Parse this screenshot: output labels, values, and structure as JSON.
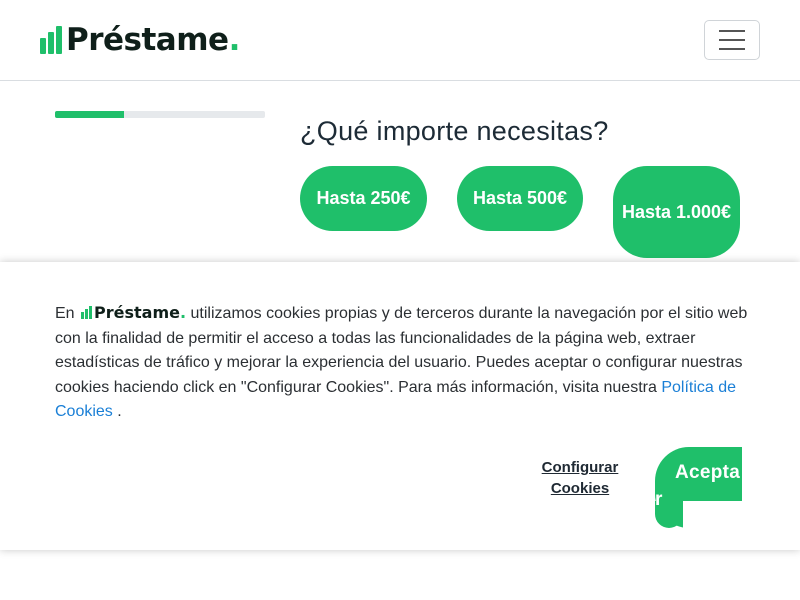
{
  "header": {
    "logo_text": "Préstame",
    "logo_dot": ".",
    "menu_icon": "hamburger-icon"
  },
  "progress": {
    "fraction": 0.33
  },
  "question": {
    "title": "¿Qué importe necesitas?",
    "options": [
      "Hasta 250€",
      "Hasta 500€",
      "Hasta 1.000€"
    ]
  },
  "cookie": {
    "prefix": "En",
    "brand": "Préstame",
    "brand_dot": ".",
    "text": "utilizamos cookies propias y de terceros durante la navegación por el sitio web con la finalidad de permitir el acceso a todas las funcionalidades de la página web, extraer estadísticas de tráfico y mejorar la experiencia del usuario. Puedes aceptar o configurar nuestras cookies haciendo click en \"Configurar Cookies\". Para más información, visita nuestra",
    "link_text": "Política de Cookies",
    "suffix": ".",
    "configure_label": "Configurar Cookies",
    "accept_label_part1": "Acepta",
    "accept_label_part2": "r"
  },
  "colors": {
    "brand_green": "#1fbf6a",
    "link_blue": "#1a7fd6",
    "dark_text": "#0f1f1a"
  }
}
